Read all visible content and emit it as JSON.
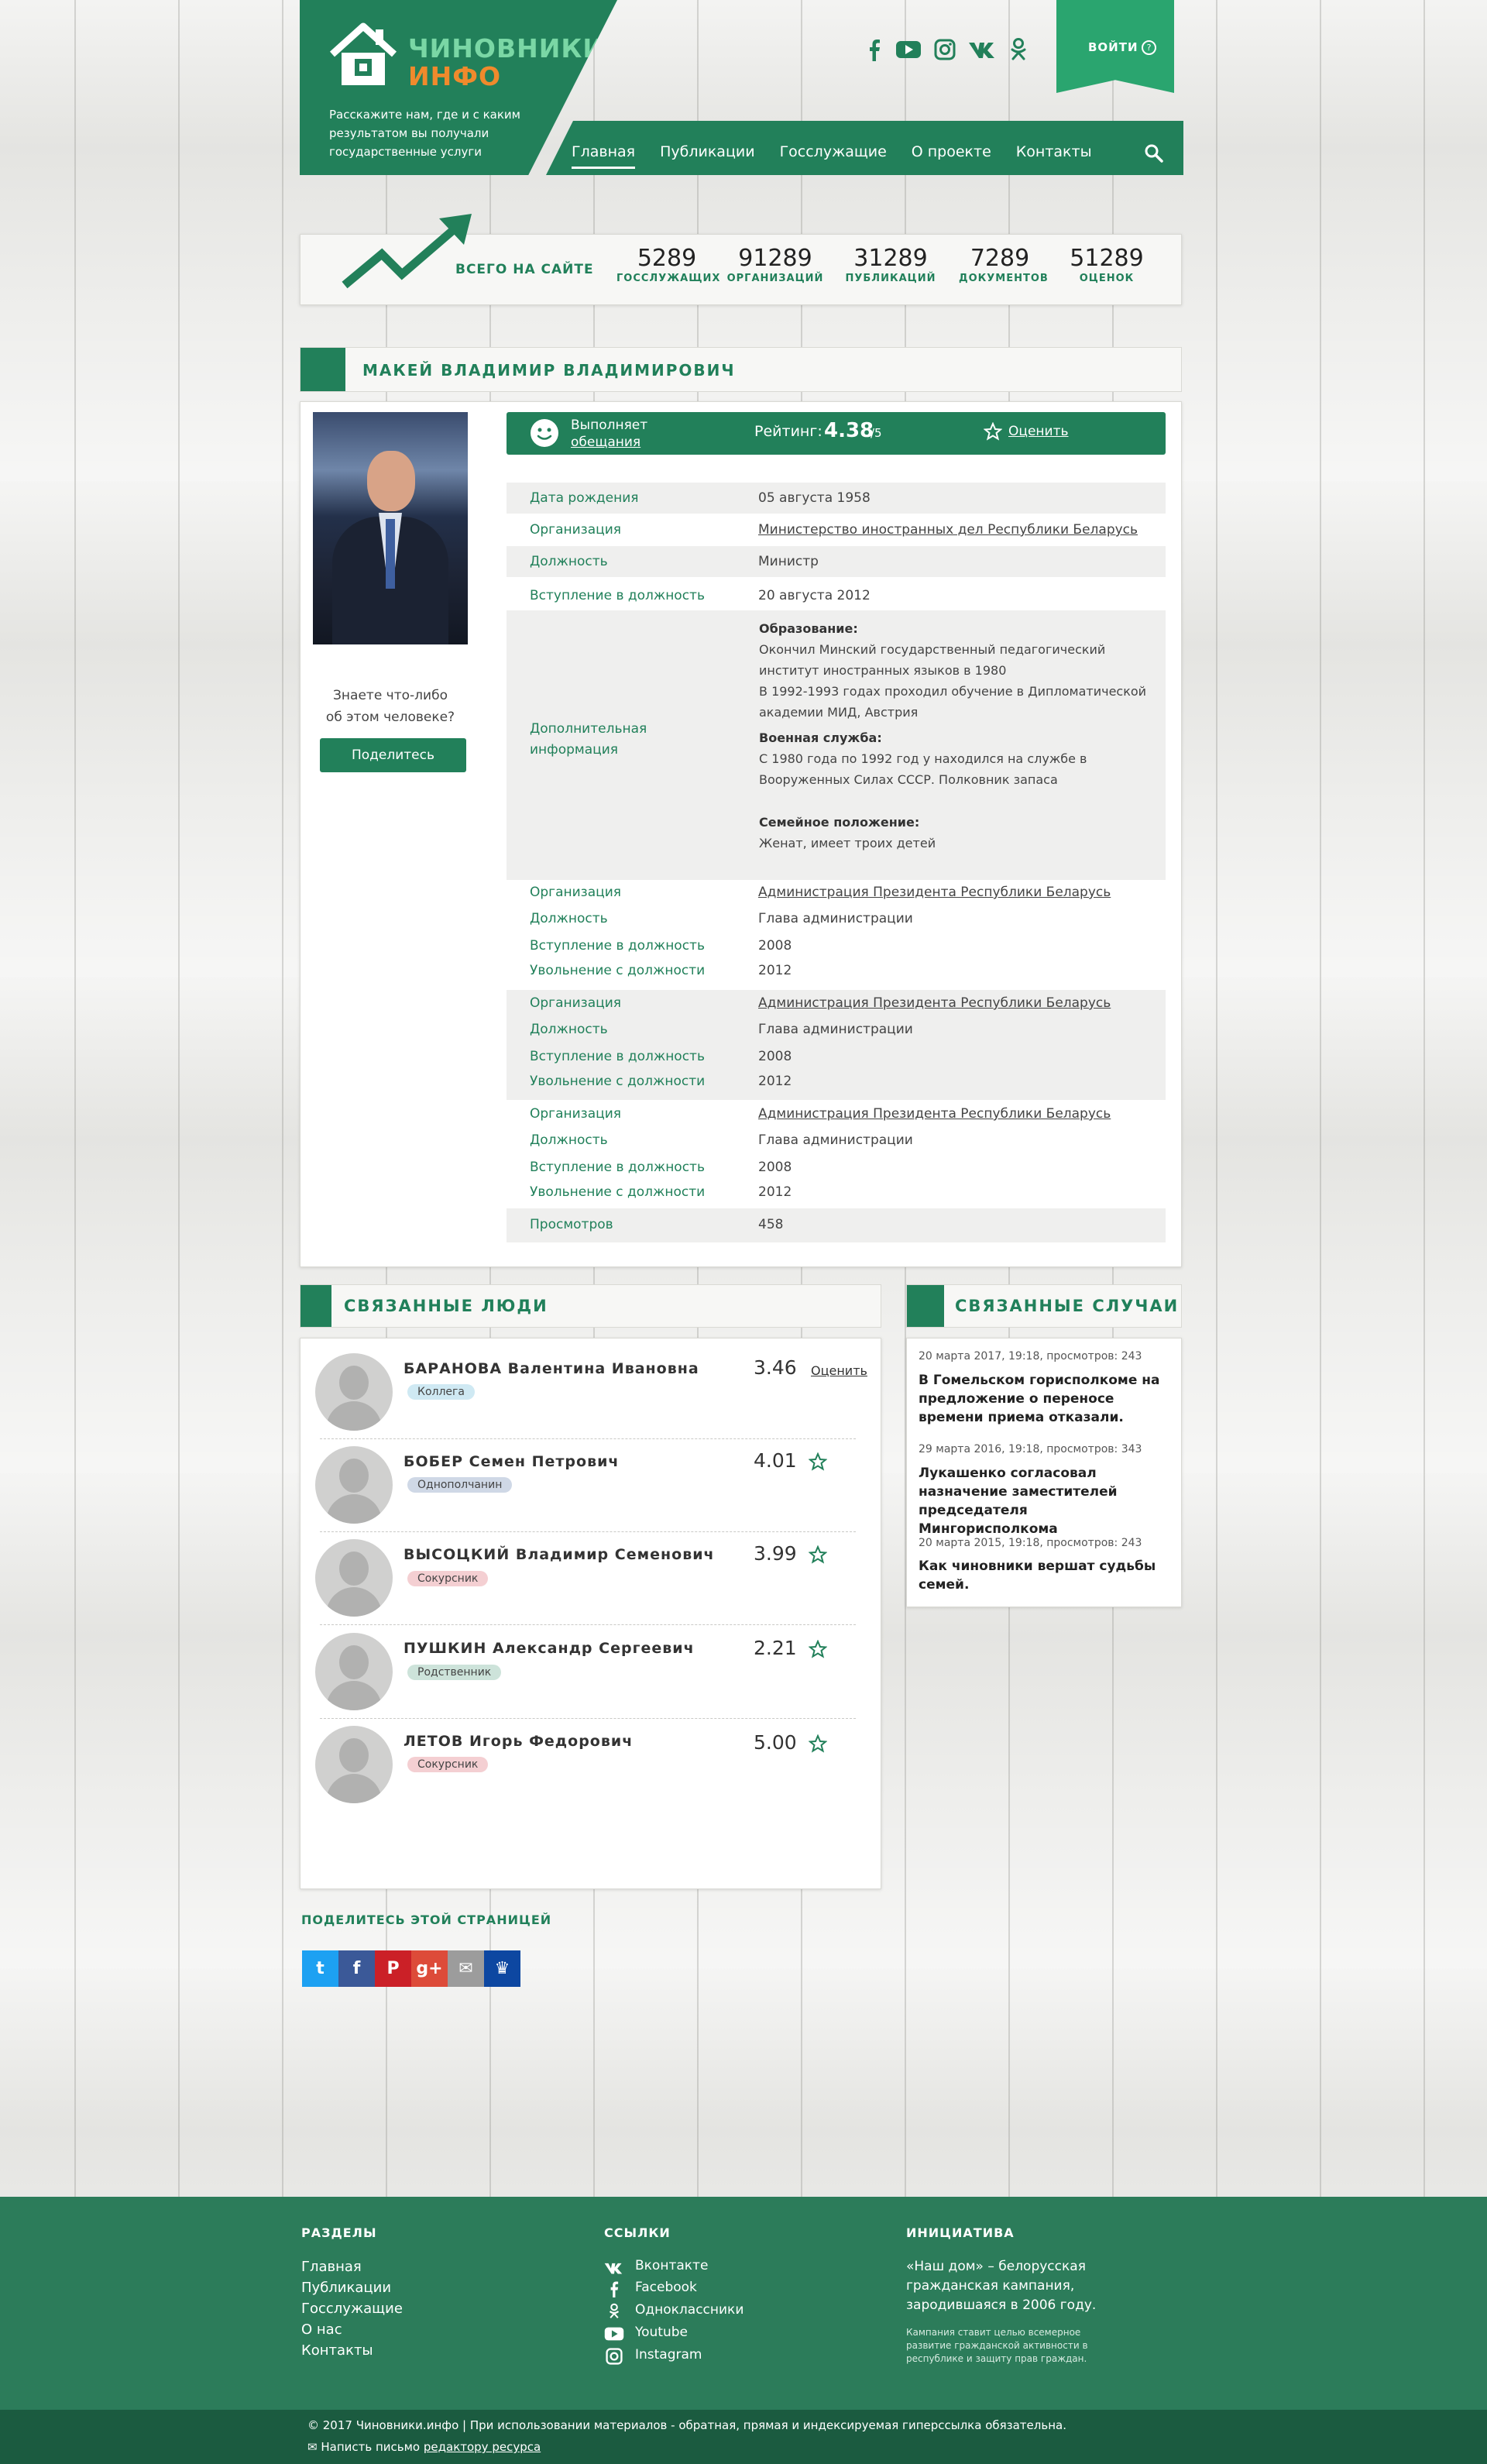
{
  "header": {
    "logo_line1": "ЧИНОВНИКИ",
    "logo_line2": "ИНФО",
    "tagline": "Расскажите нам, где и с каким результатом вы получали государственные услуги",
    "nav": [
      "Главная",
      "Публикации",
      "Госслужащие",
      "О проекте",
      "Контакты"
    ],
    "login": "ВОЙТИ",
    "social_icons": [
      "facebook-icon",
      "youtube-icon",
      "instagram-icon",
      "vk-icon",
      "odnoklassniki-icon"
    ]
  },
  "stats": {
    "label": "ВСЕГО НА САЙТЕ",
    "items": [
      {
        "num": "5289",
        "label": "ГОССЛУЖАЩИХ"
      },
      {
        "num": "91289",
        "label": "ОРГАНИЗАЦИЙ"
      },
      {
        "num": "31289",
        "label": "ПУБЛИКАЦИЙ"
      },
      {
        "num": "7289",
        "label": "ДОКУМЕНТОВ"
      },
      {
        "num": "51289",
        "label": "ОЦЕНОК"
      }
    ]
  },
  "profile": {
    "name": "МАКЕЙ ВЛАДИМИР ВЛАДИМИРОВИЧ",
    "know_text_1": "Знаете что-либо",
    "know_text_2": "об этом человеке?",
    "share_button": "Поделитесь",
    "fulfils_1": "Выполняет",
    "fulfils_2": "обещания",
    "rating_label": "Рейтинг:",
    "rating_value": "4.38",
    "rating_max": "/5",
    "rate_link": "Оценить",
    "birth_label": "Дата рождения",
    "birth_value": "05 августа 1958",
    "org_label": "Организация",
    "org_value": "Министерство иностранных дел Республики Беларусь",
    "pos_label": "Должность",
    "pos_value": "Министр",
    "start_label": "Вступление в должность",
    "start_value": "20 августа 2012",
    "extra_label": "Дополнительная информация",
    "edu_title": "Образование:",
    "edu_text_1": "Окончил Минский государственный педагогический институт иностранных языков в 1980",
    "edu_text_2": "В 1992-1993 годах проходил обучение в Дипломатической академии МИД, Австрия",
    "mil_title": "Военная служба:",
    "mil_text": "С 1980 года по 1992 год у находился на службе в Вооруженных Силах СССР.  Полковник запаса",
    "fam_title": "Семейное положение:",
    "fam_text": "Женат, имеет троих детей",
    "history": [
      {
        "org_label": "Организация",
        "org": "Администрация Президента Республики Беларусь",
        "pos_label": "Должность",
        "pos": "Глава администрации",
        "start_label": "Вступление в должность",
        "start": "2008",
        "end_label": "Увольнение с должности",
        "end": "2012"
      },
      {
        "org_label": "Организация",
        "org": "Администрация Президента Республики Беларусь",
        "pos_label": "Должность",
        "pos": "Глава администрации",
        "start_label": "Вступление в должность",
        "start": "2008",
        "end_label": "Увольнение с должности",
        "end": "2012"
      },
      {
        "org_label": "Организация",
        "org": "Администрация Президента Республики Беларусь",
        "pos_label": "Должность",
        "pos": "Глава администрации",
        "start_label": "Вступление в должность",
        "start": "2008",
        "end_label": "Увольнение с должности",
        "end": "2012"
      }
    ],
    "views_label": "Просмотров",
    "views_value": "458"
  },
  "related_people": {
    "title": "СВЯЗАННЫЕ ЛЮДИ",
    "rate_link": "Оценить",
    "items": [
      {
        "name": "БАРАНОВА Валентина Ивановна",
        "tag": "Коллега",
        "tag_color": "#cfe9f3",
        "score": "3.46"
      },
      {
        "name": "БОБЕР Семен Петрович",
        "tag": "Однополчанин",
        "tag_color": "#cfd8e6",
        "score": "4.01"
      },
      {
        "name": "ВЫСОЦКИЙ Владимир Семенович",
        "tag": "Сокурсник",
        "tag_color": "#f4cfd2",
        "score": "3.99"
      },
      {
        "name": "ПУШКИН Александр Сергеевич",
        "tag": "Родственник",
        "tag_color": "#cde3da",
        "score": "2.21"
      },
      {
        "name": "ЛЕТОВ Игорь Федорович",
        "tag": "Сокурсник",
        "tag_color": "#f4cfd2",
        "score": "5.00"
      }
    ]
  },
  "related_cases": {
    "title": "СВЯЗАННЫЕ СЛУЧАИ",
    "items": [
      {
        "meta": "20 марта 2017, 19:18, просмотров: 243",
        "title": "В Гомельском горисполкоме на предложение о переносе времени приема отказали."
      },
      {
        "meta": "29 марта 2016, 19:18, просмотров: 343",
        "title": "Лукашенко согласовал назначение заместителей председателя Мингорисполкома"
      },
      {
        "meta": "20 марта 2015, 19:18, просмотров: 243",
        "title": "Как чиновники вершат судьбы семей."
      }
    ]
  },
  "share": {
    "label": "ПОДЕЛИТЕСЬ ЭТОЙ СТРАНИЦЕЙ",
    "buttons": [
      {
        "icon": "twitter-icon",
        "glyph": "t",
        "color": "#1da1f2"
      },
      {
        "icon": "facebook-icon",
        "glyph": "f",
        "color": "#3b5998"
      },
      {
        "icon": "pinterest-icon",
        "glyph": "P",
        "color": "#cb2027"
      },
      {
        "icon": "google-plus-icon",
        "glyph": "g+",
        "color": "#dd4b39"
      },
      {
        "icon": "email-icon",
        "glyph": "✉",
        "color": "#9c9c9c"
      },
      {
        "icon": "vk-icon",
        "glyph": "♛",
        "color": "#0d47a1"
      }
    ]
  },
  "footer": {
    "sections_title": "РАЗДЕЛЫ",
    "sections": [
      "Главная",
      "Публикации",
      "Госслужащие",
      "О нас",
      "Контакты"
    ],
    "links_title": "ССЫЛКИ",
    "links": [
      {
        "label": "Вконтакте",
        "icon": "vk-icon"
      },
      {
        "label": "Facebook",
        "icon": "facebook-icon"
      },
      {
        "label": "Одноклассники",
        "icon": "odnoklassniki-icon"
      },
      {
        "label": "Youtube",
        "icon": "youtube-icon"
      },
      {
        "label": "Instagram",
        "icon": "instagram-icon"
      }
    ],
    "initiative_title": "ИНИЦИАТИВА",
    "initiative_text": "«Наш дом» – белорусская гражданская кампания, зародившаяся в 2006 году.",
    "initiative_small": "Кампания ставит целью всемерное развитие гражданской активности в республике и защиту прав граждан.",
    "copyright": "© 2017 Чиновники.инфо | При использовании материалов - обратная, прямая и индексируемая гиперссылка обязательна.",
    "mail_text": "Написть письмо ",
    "mail_link": "редактору ресурса"
  },
  "colors": {
    "brand_green": "#22805a",
    "accent_orange": "#f08a2c",
    "logo_green": "#7ad7a5"
  }
}
